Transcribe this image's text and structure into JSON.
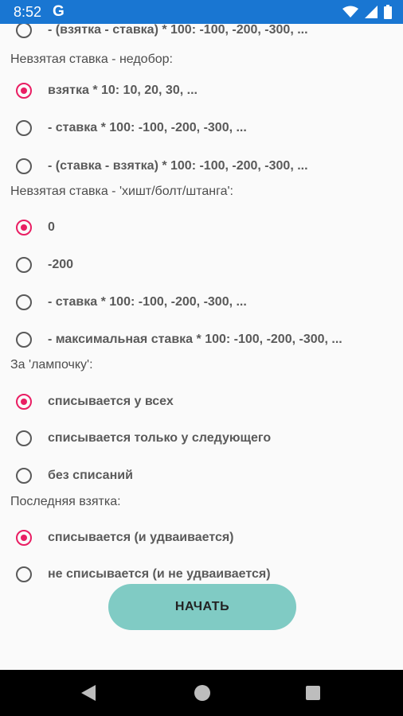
{
  "status": {
    "time": "8:52",
    "google_label": "G"
  },
  "partial_option": "- (взятка - ставка) * 100: -100, -200, -300, ...",
  "sections": [
    {
      "title": "Невзятая ставка - недобор:",
      "options": [
        {
          "label": "взятка * 10: 10, 20, 30, ...",
          "checked": true
        },
        {
          "label": "- ставка * 100: -100, -200, -300, ...",
          "checked": false
        },
        {
          "label": "- (ставка - взятка) * 100: -100, -200, -300, ...",
          "checked": false
        }
      ]
    },
    {
      "title": "Невзятая ставка - 'хишт/болт/штанга':",
      "options": [
        {
          "label": "0",
          "checked": true
        },
        {
          "label": "-200",
          "checked": false
        },
        {
          "label": "- ставка * 100: -100, -200, -300, ...",
          "checked": false
        },
        {
          "label": "- максимальная ставка * 100: -100, -200, -300, ...",
          "checked": false
        }
      ]
    },
    {
      "title": "За 'лампочку':",
      "options": [
        {
          "label": "списывается у всех",
          "checked": true
        },
        {
          "label": "списывается только у следующего",
          "checked": false
        },
        {
          "label": "без списаний",
          "checked": false
        }
      ]
    },
    {
      "title": "Последняя взятка:",
      "options": [
        {
          "label": "списывается (и удваивается)",
          "checked": true
        },
        {
          "label": "не списывается (и не удваивается)",
          "checked": false
        }
      ]
    }
  ],
  "start_button": "НАЧАТЬ",
  "colors": {
    "accent": "#e91e63",
    "button": "#80cbc4",
    "statusbar": "#1976d2"
  },
  "icons": [
    "wifi-icon",
    "signal-icon",
    "battery-icon",
    "back-icon",
    "home-icon",
    "recents-icon"
  ]
}
